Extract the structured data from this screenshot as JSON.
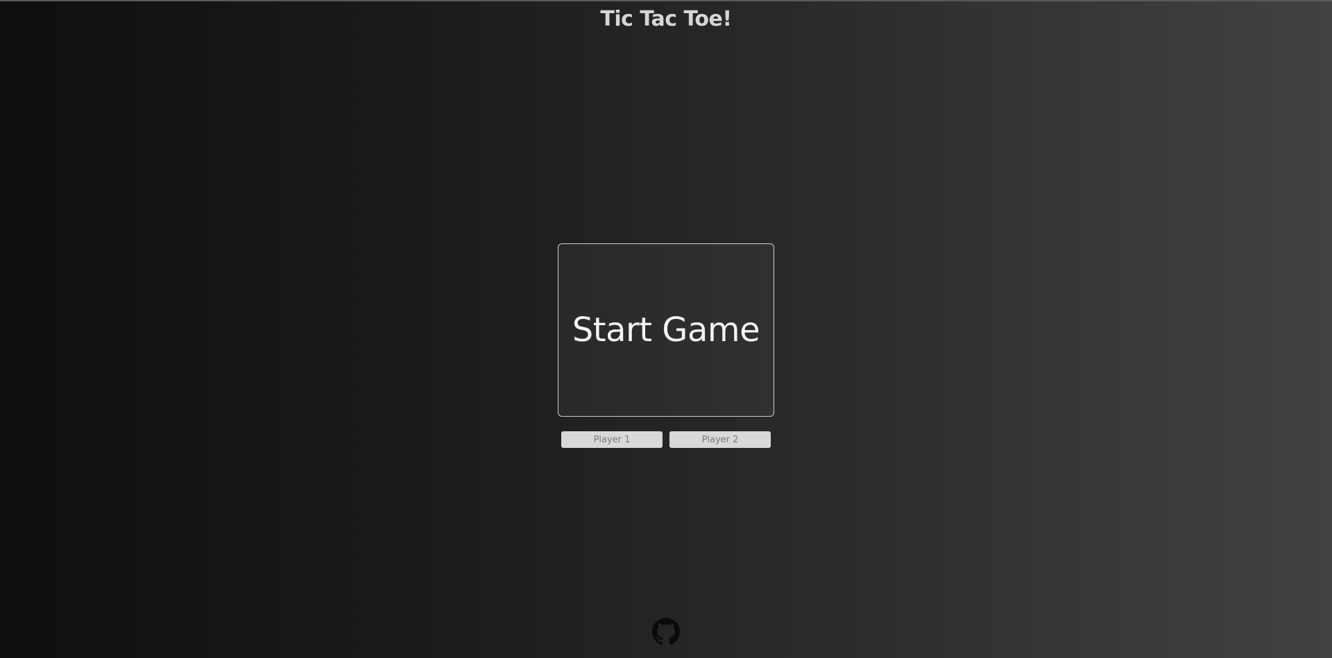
{
  "header": {
    "title": "Tic Tac Toe!"
  },
  "board": {
    "start_label": "Start Game"
  },
  "players": {
    "player1_placeholder": "Player 1",
    "player2_placeholder": "Player 2"
  },
  "footer": {
    "icon": "github-icon"
  },
  "colors": {
    "background_dark": "#0f0f0f",
    "background_light": "#434243",
    "title": "#d6d6d6",
    "board_border": "#cfcfcf",
    "input_bg": "#d9d9d9"
  }
}
